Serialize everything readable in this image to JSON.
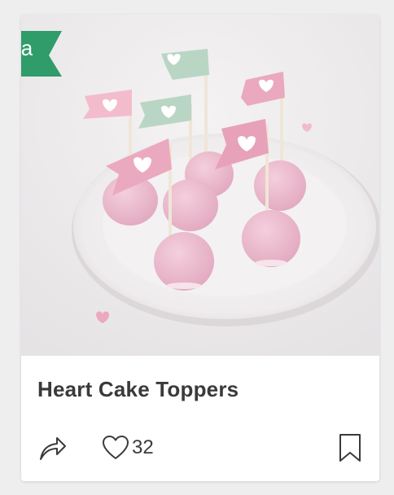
{
  "card": {
    "image_alt": "Pink cake pops with heart flag toppers on a white plate",
    "title": "Heart Cake Toppers",
    "likes": "32"
  },
  "badge": {
    "letter": "a",
    "color": "#2f9c6a"
  },
  "icons": {
    "share": "share-arrow-icon",
    "like": "heart-outline-icon",
    "bookmark": "bookmark-outline-icon"
  }
}
